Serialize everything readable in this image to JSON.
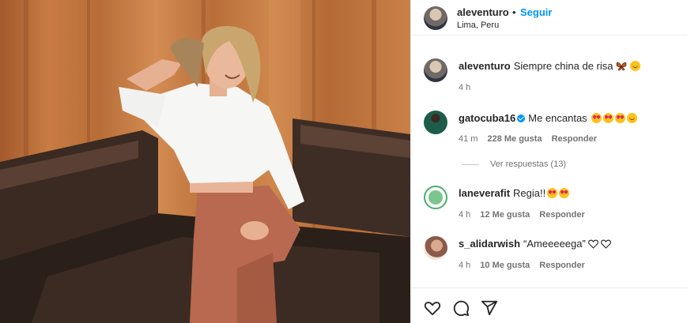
{
  "post": {
    "username": "aleventuro",
    "separator": "•",
    "follow_label": "Seguir",
    "location": "Lima, Peru"
  },
  "caption": {
    "username": "aleventuro",
    "text": "Siempre china de risa",
    "time": "4 h",
    "emojis": [
      "butterfly",
      "grinning-face"
    ]
  },
  "comments": [
    {
      "username": "gatocuba16",
      "verified": true,
      "text": "Me encantas",
      "emojis": [
        "heart-eyes",
        "heart-eyes",
        "heart-eyes",
        "grinning-face"
      ],
      "time": "41 m",
      "likes": "228 Me gusta",
      "reply": "Responder"
    },
    {
      "username": "laneverafit",
      "text": "Regia!!",
      "emojis": [
        "heart-eyes"
      ],
      "time": "4 h",
      "likes": "12 Me gusta",
      "reply": "Responder"
    },
    {
      "username": "s_alidarwish",
      "text": "“Ameeeeega”",
      "emojis": [
        "white-heart",
        "white-heart"
      ],
      "time": "4 h",
      "likes": "10 Me gusta",
      "reply": "Responder"
    }
  ],
  "view_replies": "Ver respuestas (13)",
  "actions": [
    "heart-icon",
    "comment-icon",
    "share-icon"
  ]
}
